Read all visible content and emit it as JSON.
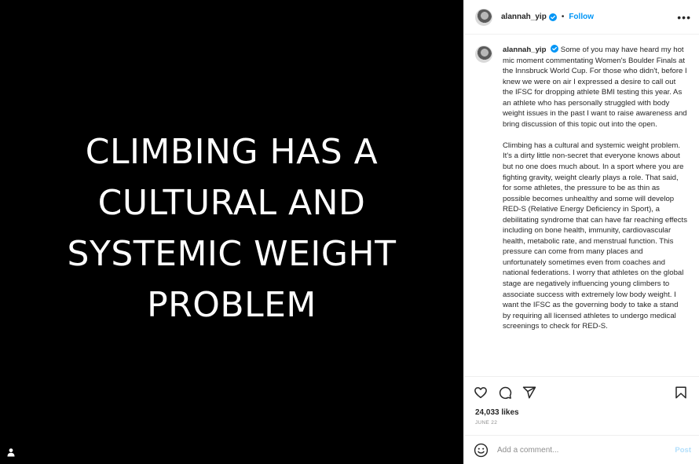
{
  "media": {
    "lines": [
      "CLIMBING HAS A",
      "CULTURAL AND",
      "SYSTEMIC WEIGHT",
      "PROBLEM"
    ],
    "background": "#000000",
    "tag_icon": "person-tag-icon"
  },
  "header": {
    "username": "alannah_yip",
    "separator": "•",
    "follow_label": "Follow",
    "more_label": "•••"
  },
  "caption": {
    "username": "alannah_yip",
    "paragraphs": [
      "Some of you may have heard my hot mic moment commentating Women's Boulder Finals at the Innsbruck World Cup. For those who didn't, before I knew we were on air I expressed a desire to call out the IFSC for dropping athlete BMI testing this year. As an athlete who has personally struggled with body weight issues in the past I want to raise awareness and bring discussion of this topic out into the open.",
      "Climbing has a cultural and systemic weight problem. It's a dirty little non-secret that everyone knows about but no one does much about. In a sport where you are fighting gravity, weight clearly plays a role. That said, for some athletes, the pressure to be as thin as possible becomes unhealthy and some will develop RED-S (Relative Energy Deficiency in Sport), a debilitating syndrome that can have far reaching effects including on bone health, immunity, cardiovascular health, metabolic rate, and menstrual function. This pressure can come from many places and unfortunately sometimes even from coaches and national federations. I worry that athletes on the global stage are negatively influencing young climbers to associate success with extremely low body weight. I want the IFSC as the governing body to take a stand by requiring all licensed athletes to undergo medical screenings to check for RED-S."
    ]
  },
  "actions": {
    "icons": [
      "heart-icon",
      "comment-icon",
      "share-icon",
      "bookmark-icon"
    ]
  },
  "likes": "24,033 likes",
  "date": "JUNE 22",
  "comment": {
    "placeholder": "Add a comment...",
    "post_label": "Post",
    "emoji_icon": "emoji-icon"
  },
  "colors": {
    "accent": "#0095f6",
    "post_disabled": "#b2dffc",
    "muted": "#8e8e8e",
    "text": "#262626",
    "divider": "#efefef"
  }
}
